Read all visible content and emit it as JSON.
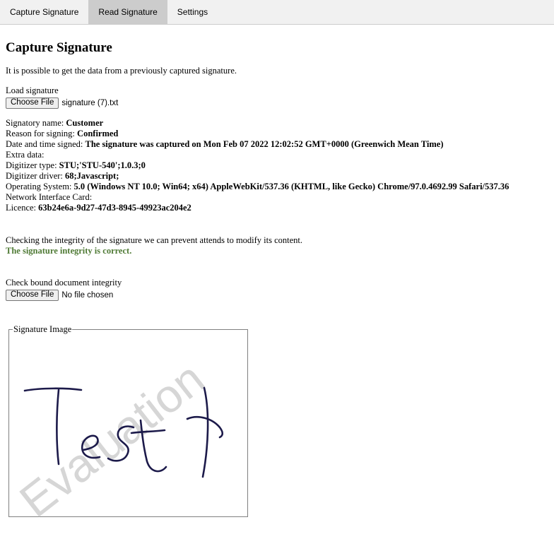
{
  "tabs": [
    {
      "label": "Capture Signature",
      "active": false
    },
    {
      "label": "Read Signature",
      "active": true
    },
    {
      "label": "Settings",
      "active": false
    }
  ],
  "page": {
    "title": "Capture Signature",
    "intro": "It is possible to get the data from a previously captured signature."
  },
  "load": {
    "label": "Load signature",
    "button": "Choose File",
    "file_name": "signature (7).txt"
  },
  "signature_info": {
    "signatory_label": "Signatory name:",
    "signatory_value": "Customer",
    "reason_label": "Reason for signing:",
    "reason_value": "Confirmed",
    "datetime_label": "Date and time signed:",
    "datetime_value": "The signature was captured on Mon Feb 07 2022 12:02:52 GMT+0000 (Greenwich Mean Time)",
    "extra_label": "Extra data:",
    "digitizer_type_label": "Digitizer type:",
    "digitizer_type_value": "STU;'STU-540';1.0.3;0",
    "digitizer_driver_label": "Digitizer driver:",
    "digitizer_driver_value": "68;Javascript;",
    "os_label": "Operating System:",
    "os_value": "5.0 (Windows NT 10.0; Win64; x64) AppleWebKit/537.36 (KHTML, like Gecko) Chrome/97.0.4692.99 Safari/537.36",
    "nic_label": "Network Interface Card:",
    "licence_label": "Licence:",
    "licence_value": "63b24e6a-9d27-47d3-8945-49923ac204e2"
  },
  "integrity": {
    "note": "Checking the integrity of the signature we can prevent attends to modify its content.",
    "status": "The signature integrity is correct.",
    "status_color": "#4f7a35"
  },
  "bound_document": {
    "label": "Check bound document integrity",
    "button": "Choose File",
    "file_name": "No file chosen"
  },
  "signature_image": {
    "legend": "Signature Image",
    "signature_text": "Test",
    "watermark": "Evaluation",
    "ink_color": "#1c1a4a"
  },
  "colors": {
    "tabbar_bg": "#f1f1f1",
    "active_tab_bg": "#cccccc"
  }
}
